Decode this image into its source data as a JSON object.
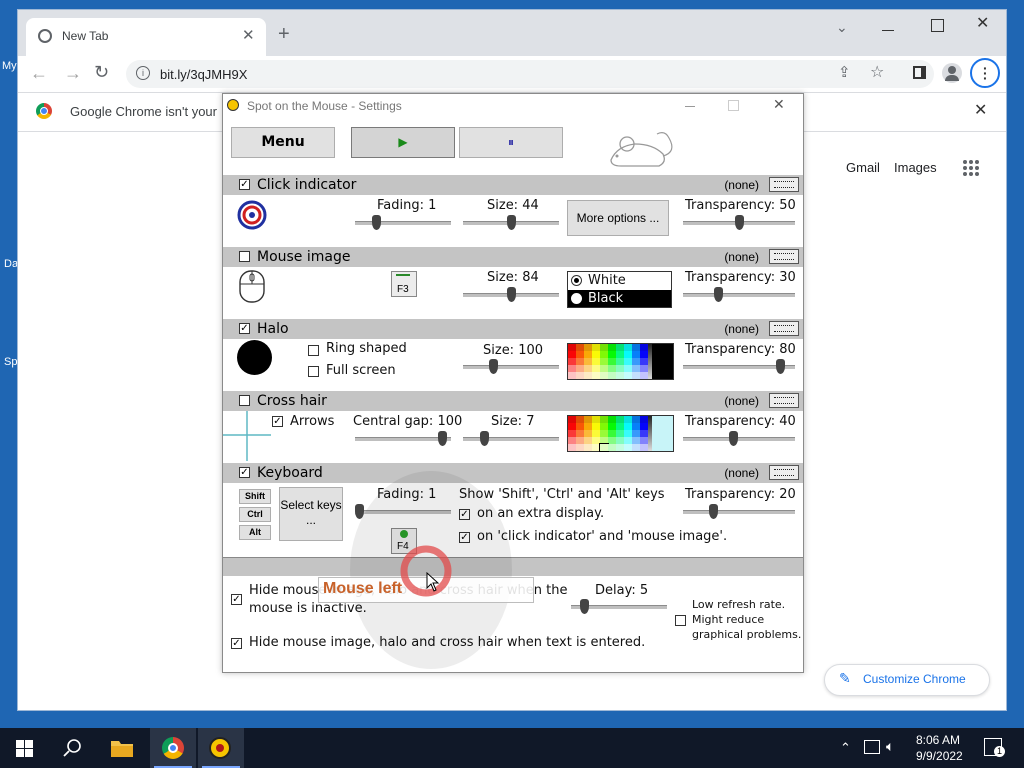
{
  "desktop": {
    "icons": [
      "My",
      "Da",
      "Sp"
    ]
  },
  "chrome": {
    "tab_title": "New Tab",
    "url": "bit.ly/3qJMH9X",
    "infobar_text": "Google Chrome isn't your",
    "links": {
      "gmail": "Gmail",
      "images": "Images"
    },
    "customize_label": "Customize Chrome"
  },
  "spot": {
    "title": "Spot on the Mouse - Settings",
    "menu_label": "Menu",
    "play_symbol": "▶",
    "pause_symbol": "⏸",
    "sections": {
      "click": {
        "label": "Click indicator",
        "checked": true,
        "shortcut": "(none)",
        "fading_label": "Fading: 1",
        "size_label": "Size: 44",
        "more_options": "More options ...",
        "transparency_label": "Transparency: 50",
        "fading": 0.2,
        "size": 0.5,
        "transparency": 0.5
      },
      "mouse": {
        "label": "Mouse image",
        "checked": false,
        "shortcut": "(none)",
        "f3_label": "F3",
        "size_label": "Size: 84",
        "white_label": "White",
        "black_label": "Black",
        "transparency_label": "Transparency: 30",
        "size": 0.5,
        "transparency": 0.3
      },
      "halo": {
        "label": "Halo",
        "checked": true,
        "shortcut": "(none)",
        "ring_label": "Ring shaped",
        "full_label": "Full screen",
        "size_label": "Size: 100",
        "transparency_label": "Transparency: 80",
        "size": 0.3,
        "transparency": 0.9
      },
      "cross": {
        "label": "Cross hair",
        "checked": false,
        "shortcut": "(none)",
        "arrows_label": "Arrows",
        "gap_label": "Central gap: 100",
        "size_label": "Size: 7",
        "transparency_label": "Transparency: 40",
        "gap": 0.95,
        "size": 0.2,
        "transparency": 0.45
      },
      "keyboard": {
        "label": "Keyboard",
        "checked": true,
        "shortcut": "(none)",
        "shift": "Shift",
        "ctrl": "Ctrl",
        "alt": "Alt",
        "select_keys": "Select keys ...",
        "fading_label": "Fading: 1",
        "f4_label": "F4",
        "show_label": "Show 'Shift', 'Ctrl' and 'Alt' keys",
        "extra_label": "on an extra display.",
        "click_label": "on 'click indicator' and 'mouse image'.",
        "transparency_label": "Transparency: 20",
        "fading": 0.0,
        "transparency": 0.25
      }
    },
    "bottom": {
      "hide_inactive_1": "Hide mouse image, halo and cross hair when the",
      "hide_inactive_2": "mouse is inactive.",
      "delay_label": "Delay: 5",
      "low_refresh_1": "Low refresh rate.",
      "low_refresh_2": "Might reduce",
      "low_refresh_3": "graphical problems.",
      "hide_text": "Hide mouse image, halo and cross hair when text is entered.",
      "delay": 0.1
    },
    "overlay_label": "Mouse left"
  },
  "taskbar": {
    "time": "8:06 AM",
    "date": "9/9/2022",
    "notif_count": "1"
  },
  "colors": {
    "section_bg": "#c4c4c4",
    "desktop_bg": "#1f66b3",
    "overlay_text": "#c8622a",
    "link_blue": "#1a73e8"
  }
}
